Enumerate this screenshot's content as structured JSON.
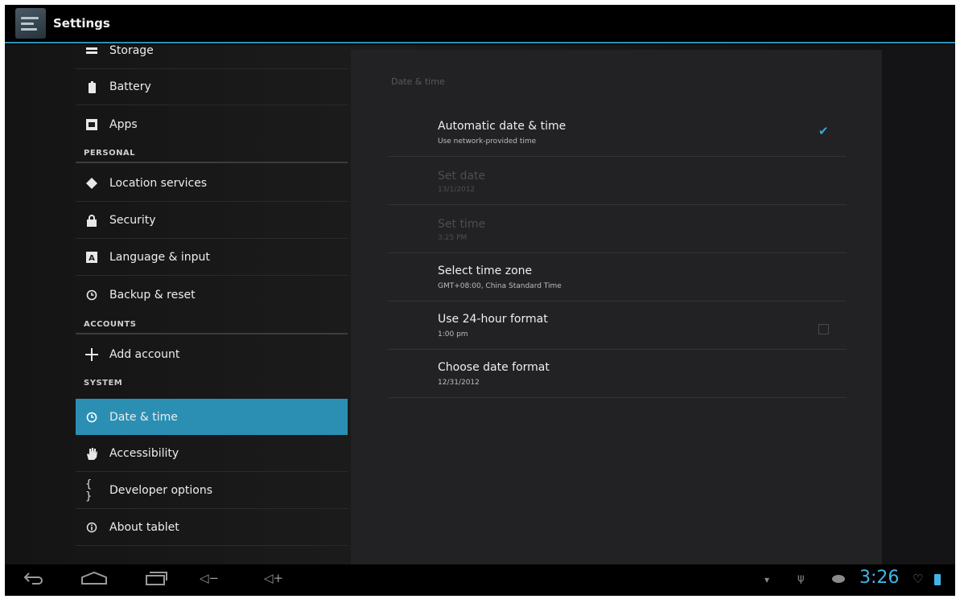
{
  "action_bar": {
    "title": "Settings",
    "icon": "settings-icon"
  },
  "sidebar": {
    "items": [
      {
        "label": "Storage",
        "icon": "storage-icon"
      },
      {
        "label": "Battery",
        "icon": "battery-icon"
      },
      {
        "label": "Apps",
        "icon": "apps-icon"
      },
      {
        "label": "Location services",
        "icon": "location-icon"
      },
      {
        "label": "Security",
        "icon": "lock-icon"
      },
      {
        "label": "Language & input",
        "icon": "keyboard-icon"
      },
      {
        "label": "Backup & reset",
        "icon": "backup-icon"
      },
      {
        "label": "Add account",
        "icon": "plus-icon"
      },
      {
        "label": "Date & time",
        "icon": "clock-icon",
        "selected": true
      },
      {
        "label": "Accessibility",
        "icon": "hand-icon"
      },
      {
        "label": "Developer options",
        "icon": "braces-icon"
      },
      {
        "label": "About tablet",
        "icon": "info-icon"
      }
    ],
    "headers": {
      "personal": "PERSONAL",
      "accounts": "ACCOUNTS",
      "system": "SYSTEM"
    }
  },
  "detail": {
    "title": "Date & time",
    "prefs": [
      {
        "title": "Automatic date & time",
        "summary": "Use network-provided time",
        "checkbox": true,
        "checked": true,
        "enabled": true
      },
      {
        "title": "Set date",
        "summary": "13/1/2012",
        "enabled": false
      },
      {
        "title": "Set time",
        "summary": "3:25 PM",
        "enabled": false
      },
      {
        "title": "Select time zone",
        "summary": "GMT+08:00, China Standard Time",
        "enabled": true
      },
      {
        "title": "Use 24-hour format",
        "summary": "1:00 pm",
        "checkbox": true,
        "checked": false,
        "enabled": true
      },
      {
        "title": "Choose date format",
        "summary": "12/31/2012",
        "enabled": true
      }
    ]
  },
  "system_bar": {
    "clock": "3:26",
    "accent": "#41b6e6"
  },
  "colors": {
    "accent": "#2b8fb3",
    "check": "#39a7d8"
  }
}
